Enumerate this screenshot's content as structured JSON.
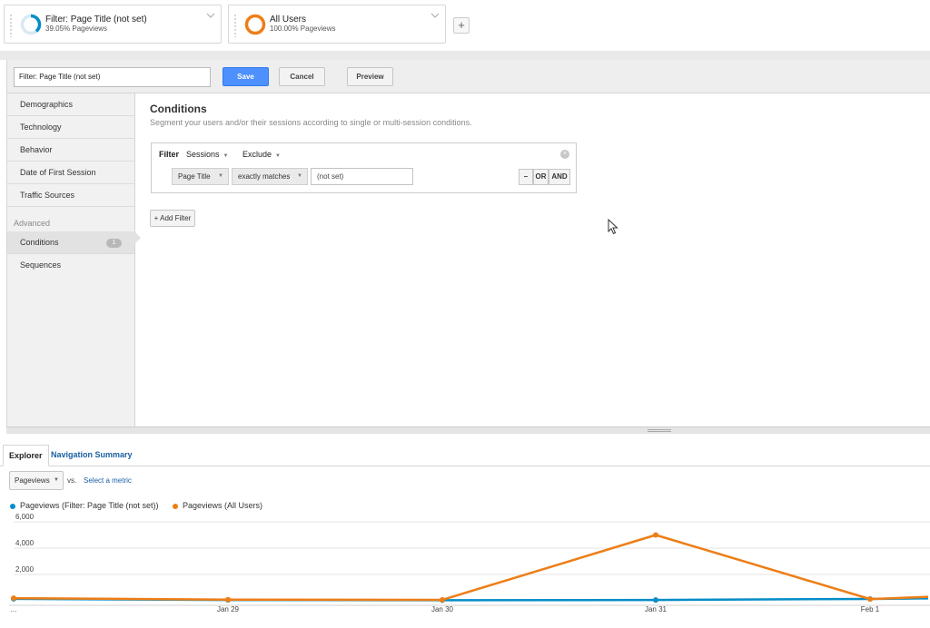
{
  "segments": [
    {
      "name": "Filter: Page Title (not set)",
      "stat": "39.05% Pageviews",
      "color": "#058dc7"
    },
    {
      "name": "All Users",
      "stat": "100.00% Pageviews",
      "color": "#ed7e17"
    }
  ],
  "add_segment_symbol": "+",
  "editor": {
    "segment_name_value": "Filter: Page Title (not set)",
    "save_label": "Save",
    "cancel_label": "Cancel",
    "preview_label": "Preview"
  },
  "sidebar": {
    "items": [
      "Demographics",
      "Technology",
      "Behavior",
      "Date of First Session",
      "Traffic Sources"
    ],
    "advanced_label": "Advanced",
    "advanced_items": [
      {
        "label": "Conditions",
        "badge": "1",
        "active": true
      },
      {
        "label": "Sequences"
      }
    ]
  },
  "conditions": {
    "title": "Conditions",
    "subtitle": "Segment your users and/or their sessions according to single or multi-session conditions.",
    "filter_label": "Filter",
    "scope": "Sessions",
    "mode": "Exclude",
    "dimension": "Page Title",
    "operator": "exactly matches",
    "value": "(not set)",
    "logic_buttons": [
      "–",
      "OR",
      "AND"
    ],
    "add_filter_label": "+ Add Filter"
  },
  "report": {
    "tabs": [
      "Explorer",
      "Navigation Summary"
    ],
    "metric": "Pageviews",
    "vs_label": "vs.",
    "select_metric_label": "Select a metric",
    "legend": [
      {
        "label": "Pageviews (Filter: Page Title (not set))",
        "color": "#058dc7"
      },
      {
        "label": "Pageviews (All Users)",
        "color": "#ed7e17"
      }
    ]
  },
  "chart_data": {
    "type": "line",
    "x_labels": [
      "...",
      "Jan 29",
      "Jan 30",
      "Jan 31",
      "Feb 1"
    ],
    "y_ticks": [
      "6,000",
      "4,000",
      "2,000"
    ],
    "ylim": [
      0,
      6000
    ],
    "series": [
      {
        "name": "Pageviews (Filter: Page Title (not set))",
        "color": "#058dc7",
        "values": [
          150,
          60,
          40,
          60,
          140,
          180
        ]
      },
      {
        "name": "Pageviews (All Users)",
        "color": "#ed7e17",
        "values": [
          200,
          90,
          70,
          5000,
          130,
          300
        ]
      }
    ]
  }
}
